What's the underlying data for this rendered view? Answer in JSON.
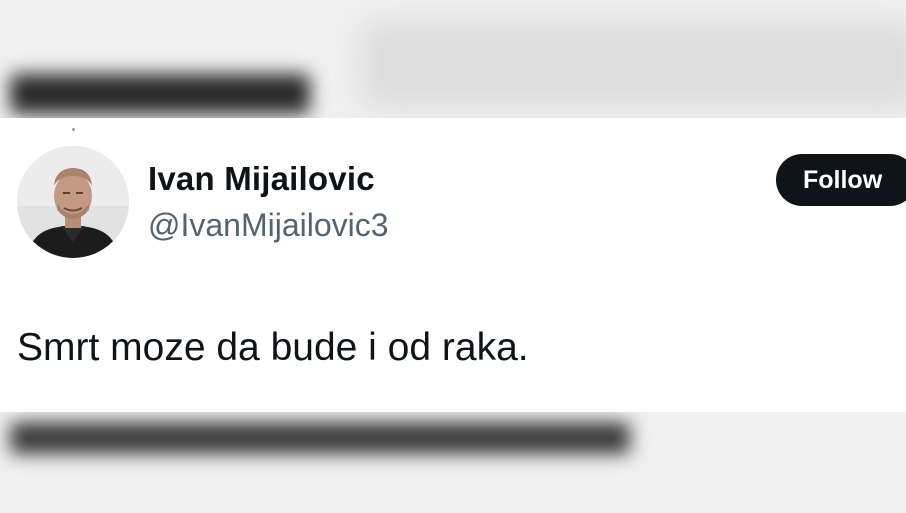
{
  "tweet": {
    "author_name": "Ivan Mijailovic",
    "author_handle": "@IvanMijailovic3",
    "follow_label": "Follow",
    "text": "Smrt moze da bude i od raka."
  },
  "icons": {
    "avatar": "profile-photo"
  },
  "colors": {
    "follow_button_bg": "#0f1419",
    "follow_button_text": "#ffffff",
    "handle_text": "#536471",
    "body_text": "#0f1419"
  }
}
